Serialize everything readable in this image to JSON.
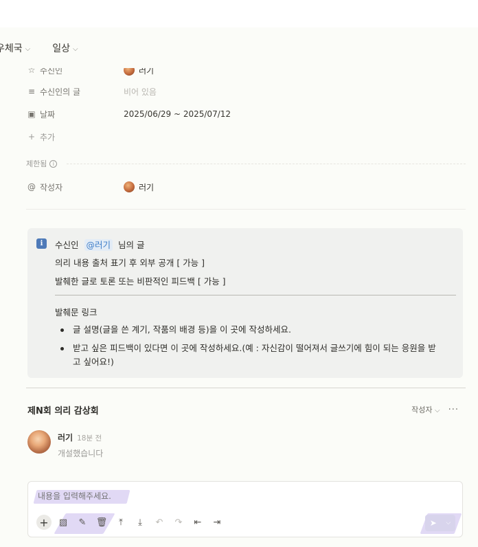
{
  "breadcrumbs": [
    {
      "label": "우체국"
    },
    {
      "label": "일상"
    }
  ],
  "properties": {
    "recipient": {
      "name": "수신인",
      "value": "러기"
    },
    "recipient_post": {
      "name": "수신인의 글",
      "value": "비어 있음"
    },
    "date": {
      "name": "날짜",
      "value": "2025/06/29 ~ 2025/07/12"
    },
    "add_label": "추가",
    "restricted_label": "제한됨",
    "author": {
      "name": "작성자",
      "value": "러기"
    }
  },
  "callout": {
    "icon": "info-icon",
    "line1_prefix": "수신인",
    "mention": "@러기",
    "line1_suffix": "님의 글",
    "line2": "의리 내용 출처 표기 후 외부 공개 [ 가능 ]",
    "line3": "발췌한 글로 토론 또는 비판적인 피드백 [ 가능 ]",
    "link_label": "발췌문 링크",
    "bullets": [
      "글 설명(글을 쓴 계기, 작품의 배경 등)을 이 곳에 작성하세요.",
      "받고 싶은 피드백이 있다면 이 곳에 작성하세요.(예 : 자신감이 떨어져서 글쓰기에 힘이 되는 응원을 받",
      "고 싶어요!)"
    ]
  },
  "comments": {
    "title": "제N회 의리 감상회",
    "filter_label": "작성자",
    "more_label": "···",
    "items": [
      {
        "author": "러기",
        "time": "18분 전",
        "body": "개설했습니다"
      }
    ]
  },
  "composer": {
    "placeholder": "내용을 입력해주세요."
  },
  "colors": {
    "mention": "#3d7dc9",
    "callout_bg": "#f0f1ef",
    "send_button": "#d8d4ec",
    "highlight": "#d7ccf2"
  }
}
